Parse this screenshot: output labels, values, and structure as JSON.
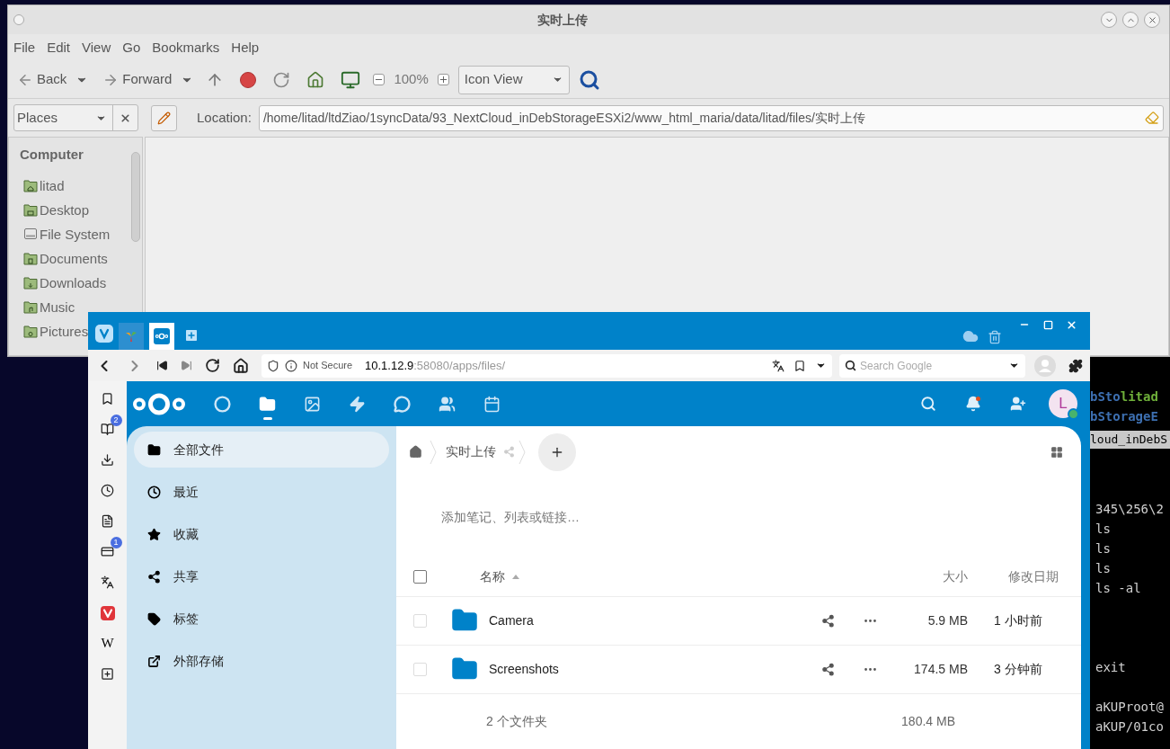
{
  "file_manager": {
    "title": "实时上传",
    "menu": [
      "File",
      "Edit",
      "View",
      "Go",
      "Bookmarks",
      "Help"
    ],
    "toolbar": {
      "back": "Back",
      "forward": "Forward",
      "zoom": "100%",
      "view": "Icon View"
    },
    "side_pane": {
      "selector": "Places",
      "heading": "Computer",
      "items": [
        {
          "label": "litad",
          "kind": "home"
        },
        {
          "label": "Desktop",
          "kind": "desktop"
        },
        {
          "label": "File System",
          "kind": "drive"
        },
        {
          "label": "Documents",
          "kind": "documents"
        },
        {
          "label": "Downloads",
          "kind": "downloads"
        },
        {
          "label": "Music",
          "kind": "music"
        },
        {
          "label": "Pictures",
          "kind": "pictures"
        }
      ]
    },
    "location": {
      "label": "Location:",
      "path": "/home/litad/ltdZiao/1syncData/93_NextCloud_inDebStorageESXi2/www_html_maria/data/litad/files/实时上传"
    }
  },
  "terminal": {
    "top_lines": [
      {
        "segments": [
          {
            "text": "bSto",
            "color": "#3d6fb0"
          },
          {
            "text": "litad",
            "color": "#6fb03a"
          }
        ]
      },
      {
        "segments": [
          {
            "text": "bStorageE",
            "color": "#3d6fb0"
          }
        ]
      }
    ],
    "tab": "loud_inDebS",
    "lines": [
      "345\\256\\2",
      "ls",
      "ls",
      "ls",
      "ls -al",
      "exit",
      "aKUProot@",
      "aKUP/01co"
    ]
  },
  "browser": {
    "tabs": [
      {
        "kind": "app",
        "selected": false
      },
      {
        "kind": "nextcloud",
        "selected": true
      }
    ],
    "address": {
      "security": "Not Secure",
      "host": "10.1.12.9",
      "rest": ":58080/apps/files/"
    },
    "search": {
      "placeholder": "Search Google"
    },
    "panel": [
      {
        "kind": "bookmark"
      },
      {
        "kind": "reader",
        "badge": "2"
      },
      {
        "kind": "download"
      },
      {
        "kind": "history"
      },
      {
        "kind": "notes"
      },
      {
        "kind": "window",
        "badge": "1"
      },
      {
        "kind": "translate"
      },
      {
        "kind": "vivaldi"
      },
      {
        "kind": "wiki",
        "label": "W"
      },
      {
        "kind": "add"
      }
    ]
  },
  "nextcloud": {
    "apps": [
      {
        "kind": "dashboard",
        "selected": false
      },
      {
        "kind": "files",
        "selected": true
      },
      {
        "kind": "photos",
        "selected": false
      },
      {
        "kind": "activity",
        "selected": false
      },
      {
        "kind": "talk",
        "selected": false
      },
      {
        "kind": "contacts",
        "selected": false
      },
      {
        "kind": "calendar",
        "selected": false
      }
    ],
    "avatar": "L",
    "nav": [
      {
        "label": "全部文件",
        "kind": "folder",
        "selected": true
      },
      {
        "label": "最近",
        "kind": "clock",
        "selected": false
      },
      {
        "label": "收藏",
        "kind": "star",
        "selected": false
      },
      {
        "label": "共享",
        "kind": "share",
        "selected": false
      },
      {
        "label": "标签",
        "kind": "tag",
        "selected": false
      },
      {
        "label": "外部存储",
        "kind": "external",
        "selected": false
      }
    ],
    "breadcrumb": "实时上传",
    "note_placeholder": "添加笔记、列表或链接…",
    "select_all": {
      "checked": false
    },
    "columns": {
      "name": "名称",
      "size": "大小",
      "modified": "修改日期"
    },
    "rows": [
      {
        "name": "Camera",
        "size": "5.9 MB",
        "modified": "1 小时前",
        "checked": false
      },
      {
        "name": "Screenshots",
        "size": "174.5 MB",
        "modified": "3 分钟前",
        "checked": false
      }
    ],
    "summary": {
      "count": "2 个文件夹",
      "size": "180.4 MB"
    }
  }
}
